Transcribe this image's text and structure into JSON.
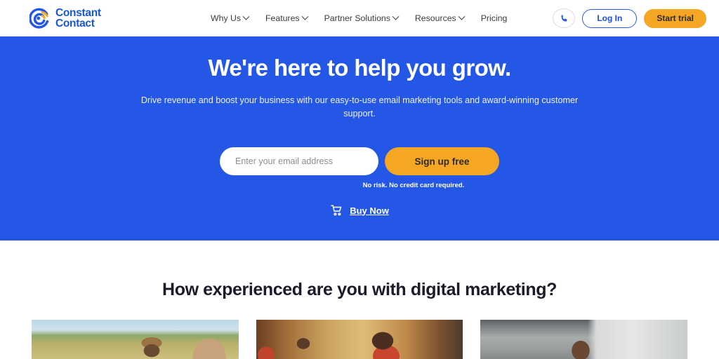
{
  "header": {
    "logo": {
      "name": "Constant Contact",
      "line1": "Constant",
      "line2": "Contact",
      "icon": "constant-contact-swirl-icon",
      "color_blue": "#1856d6",
      "color_orange": "#f5a623"
    },
    "nav": [
      {
        "label": "Why Us",
        "has_dropdown": true
      },
      {
        "label": "Features",
        "has_dropdown": true
      },
      {
        "label": "Partner Solutions",
        "has_dropdown": true
      },
      {
        "label": "Resources",
        "has_dropdown": true
      },
      {
        "label": "Pricing",
        "has_dropdown": false
      }
    ],
    "actions": {
      "phone_icon": "phone-handset-icon",
      "login_label": "Log In",
      "trial_label": "Start trial"
    }
  },
  "hero": {
    "background_color": "#2457e6",
    "title": "We're here to help you grow.",
    "subtitle": "Drive revenue and boost your business with our easy-to-use email marketing tools and award-winning customer support.",
    "email_placeholder": "Enter your email address",
    "email_value": "",
    "signup_label": "Sign up free",
    "disclaimer": "No risk. No credit card required.",
    "buy_now_label": "Buy Now",
    "cart_icon": "shopping-cart-icon"
  },
  "section": {
    "title": "How experienced are you with digital marketing?",
    "cards": [
      {
        "alt": "Man in a cap outdoors on a farm with green hills and blue sky"
      },
      {
        "alt": "People working in a warm-lit indoor workshop wearing red shirts"
      },
      {
        "alt": "Woman working at a laptop in a grey industrial space"
      }
    ]
  }
}
